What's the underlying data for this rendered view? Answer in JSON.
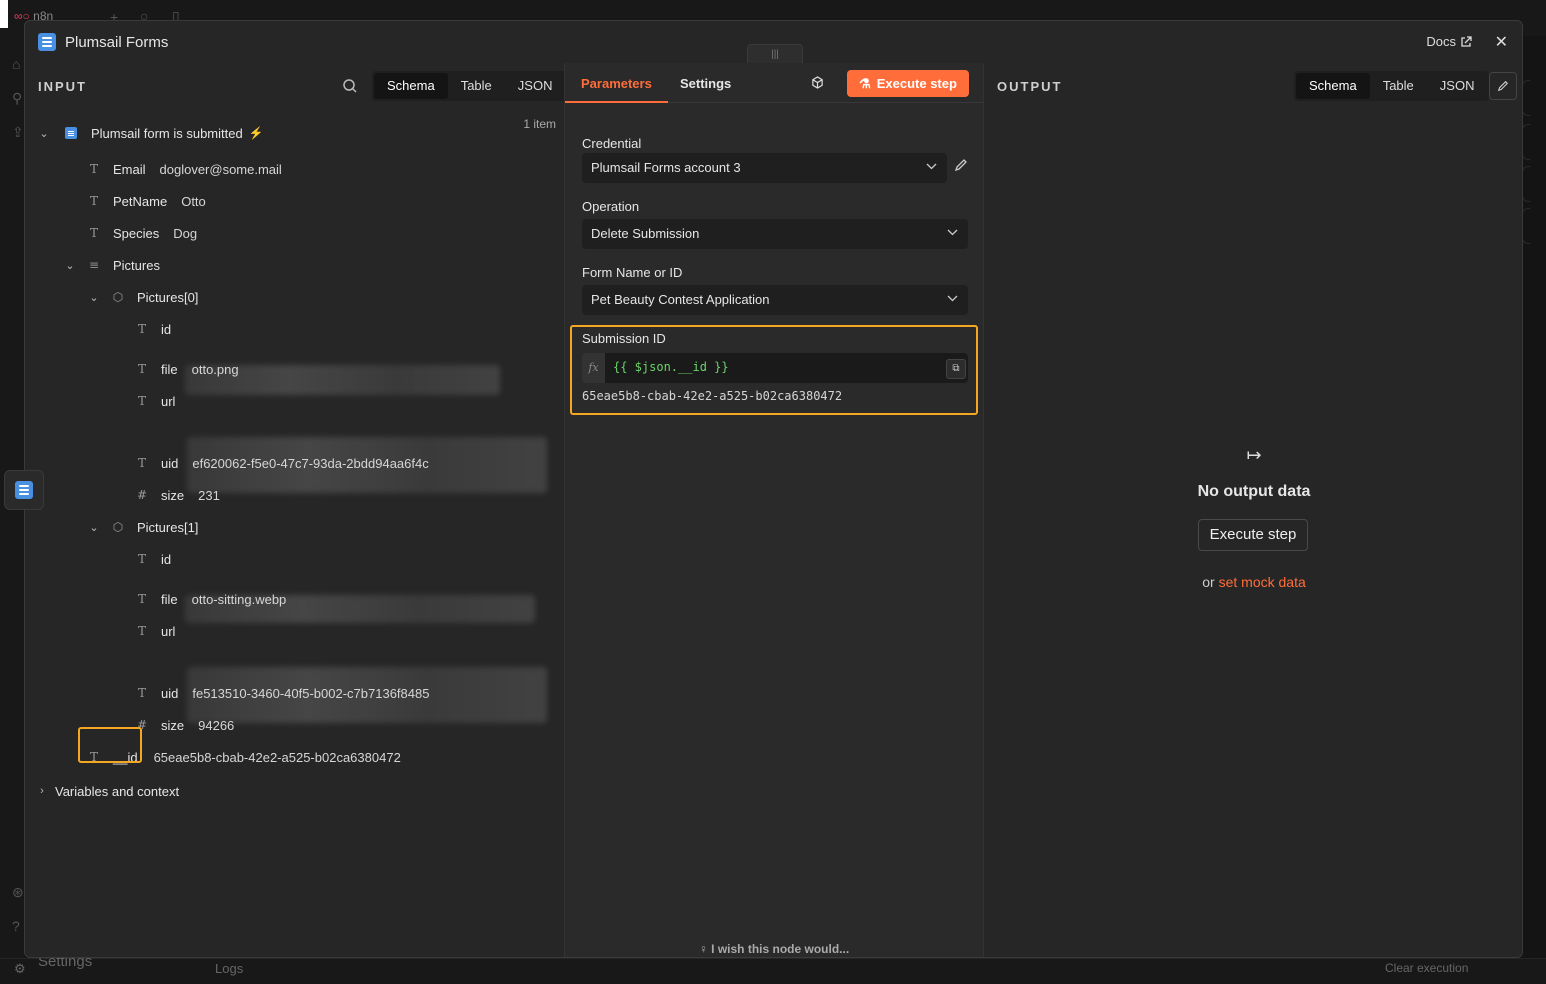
{
  "background": {
    "app_name": "n8n",
    "settings_label": "Settings",
    "logs_label": "Logs",
    "clear_execution_label": "Clear execution"
  },
  "modal": {
    "title": "Plumsail Forms",
    "docs_label": "Docs",
    "node_icon": "plumsail-forms-icon"
  },
  "input": {
    "label": "INPUT",
    "views": [
      "Schema",
      "Table",
      "JSON"
    ],
    "active_view": "Schema",
    "trigger_name": "Plumsail form is submitted",
    "item_count": "1 item",
    "fields": {
      "email_key": "Email",
      "email_val": "doglover@some.mail",
      "petname_key": "PetName",
      "petname_val": "Otto",
      "species_key": "Species",
      "species_val": "Dog",
      "pictures_key": "Pictures",
      "p0_key": "Pictures[0]",
      "p0_id_key": "id",
      "p0_file_key": "file",
      "p0_file_val": "otto.png",
      "p0_url_key": "url",
      "p0_uid_key": "uid",
      "p0_uid_val": "ef620062-f5e0-47c7-93da-2bdd94aa6f4c",
      "p0_size_key": "size",
      "p0_size_val": "231",
      "p1_key": "Pictures[1]",
      "p1_id_key": "id",
      "p1_file_key": "file",
      "p1_file_val": "otto-sitting.webp",
      "p1_url_key": "url",
      "p1_uid_key": "uid",
      "p1_uid_val": "fe513510-3460-40f5-b002-c7b7136f8485",
      "p1_size_key": "size",
      "p1_size_val": "94266",
      "id_key": "__id",
      "id_val": "65eae5b8-cbab-42e2-a525-b02ca6380472"
    },
    "variables_label": "Variables and context"
  },
  "params": {
    "tabs": [
      "Parameters",
      "Settings"
    ],
    "active_tab": "Parameters",
    "execute_label": "Execute step",
    "credential_label": "Credential",
    "credential_value": "Plumsail Forms account 3",
    "operation_label": "Operation",
    "operation_value": "Delete Submission",
    "form_label": "Form Name or ID",
    "form_value": "Pet Beauty Contest Application",
    "submission_label": "Submission ID",
    "submission_expr": "{{ $json.__id }}",
    "submission_resolved": "65eae5b8-cbab-42e2-a525-b02ca6380472",
    "fx_label": "fx",
    "wish_label": "I wish this node would..."
  },
  "output": {
    "label": "OUTPUT",
    "views": [
      "Schema",
      "Table",
      "JSON"
    ],
    "active_view": "Schema",
    "empty_title": "No output data",
    "execute_label": "Execute step",
    "or_label": "or",
    "mock_label": "set mock data"
  },
  "colors": {
    "accent": "#ff6d3a",
    "highlight": "#f5a623",
    "node_blue": "#4a90e2",
    "expression_green": "#6bd36b"
  }
}
